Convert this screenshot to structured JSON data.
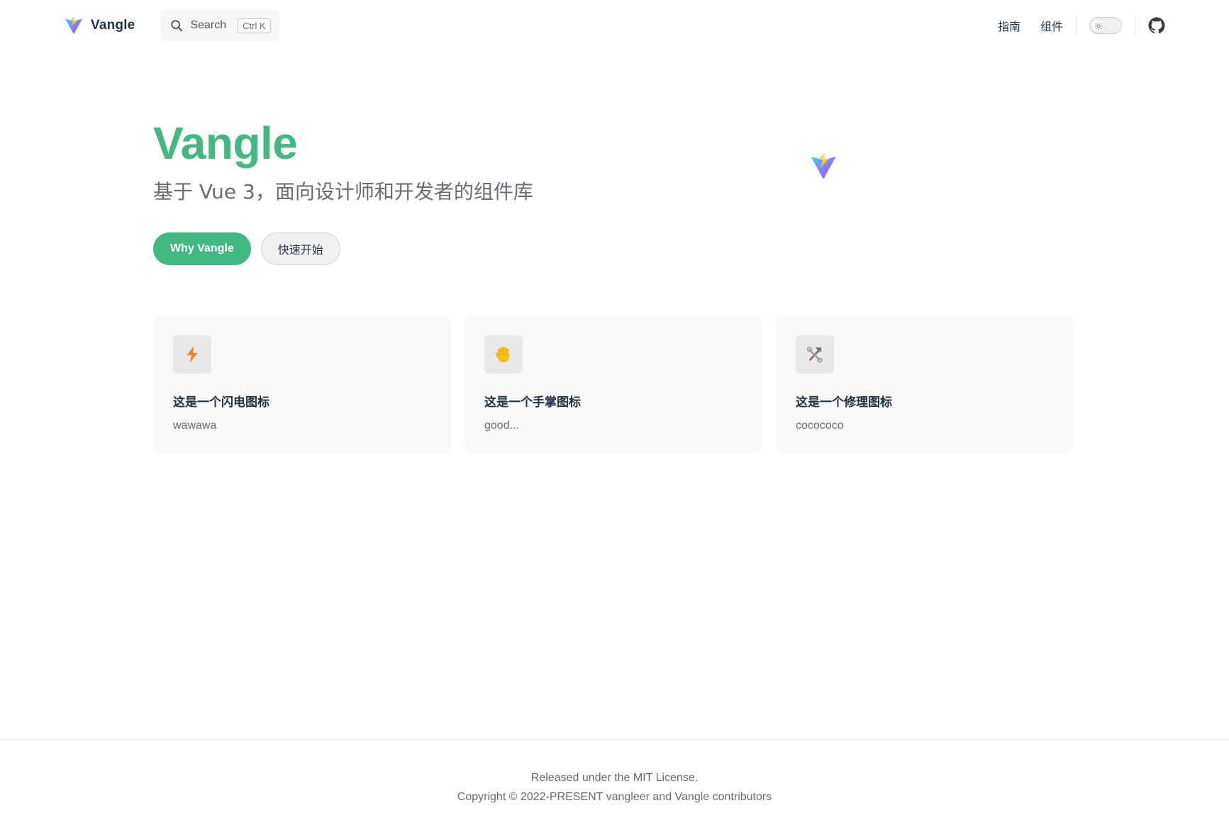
{
  "brand": {
    "title": "Vangle",
    "accent_color": "#42b883",
    "logo_icon": "vite-logo-icon"
  },
  "search": {
    "label": "Search",
    "shortcut": "Ctrl K",
    "icon": "search-icon"
  },
  "nav": {
    "links": [
      {
        "label": "指南"
      },
      {
        "label": "组件"
      }
    ],
    "theme_toggle_icon": "sun-icon",
    "social_icon": "github-icon"
  },
  "hero": {
    "name": "Vangle",
    "tagline": "基于 Vue 3，面向设计师和开发者的组件库",
    "actions": [
      {
        "label": "Why Vangle",
        "theme": "brand"
      },
      {
        "label": "快速开始",
        "theme": "alt"
      }
    ],
    "image_icon": "vite-logo-icon"
  },
  "features": [
    {
      "icon": "lightning-icon",
      "title": "这是一个闪电图标",
      "details": "wawawa"
    },
    {
      "icon": "hand-icon",
      "title": "这是一个手掌图标",
      "details": "good..."
    },
    {
      "icon": "tools-icon",
      "title": "这是一个修理图标",
      "details": "cocococo"
    }
  ],
  "footer": {
    "message": "Released under the MIT License.",
    "copyright": "Copyright © 2022-PRESENT vangleer and Vangle contributors"
  }
}
